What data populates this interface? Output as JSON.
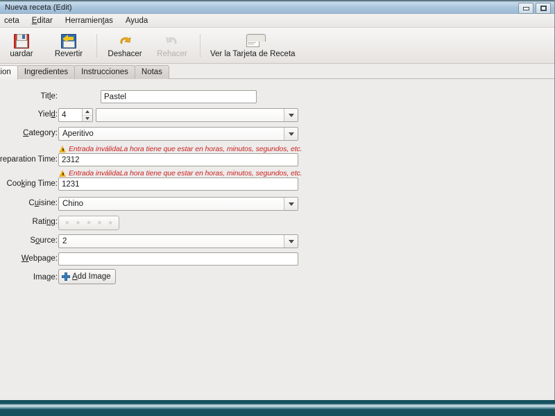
{
  "window": {
    "title": "Nueva receta (Edit)",
    "buttons": [
      {
        "name": "minimize",
        "glyph": "minimize-icon"
      },
      {
        "name": "maximize",
        "glyph": "maximize-icon"
      }
    ]
  },
  "menubar": {
    "items": [
      {
        "label": "ceta",
        "mnemonic": ""
      },
      {
        "label": "Editar",
        "mnemonic": "E"
      },
      {
        "label": "Herramientas",
        "mnemonic": "t"
      },
      {
        "label": "Ayuda",
        "mnemonic": ""
      }
    ]
  },
  "toolbar": {
    "items": [
      {
        "label": "uardar",
        "icon": "save-icon",
        "enabled": true
      },
      {
        "label": "Revertir",
        "icon": "revert-icon",
        "enabled": true
      },
      {
        "label": "Deshacer",
        "icon": "undo-icon",
        "enabled": true
      },
      {
        "label": "Rehacer",
        "icon": "redo-icon",
        "enabled": false
      },
      {
        "label": "Ver la Tarjeta de Receta",
        "icon": "recipe-card-icon",
        "enabled": true
      }
    ]
  },
  "tabs": [
    {
      "label": "scription",
      "active": true
    },
    {
      "label": "Ingredientes",
      "active": false
    },
    {
      "label": "Instrucciones",
      "active": false
    },
    {
      "label": "Notas",
      "active": false
    }
  ],
  "form": {
    "title": {
      "label": "Title:",
      "value": "Pastel"
    },
    "yield": {
      "label": "Yield:",
      "amount": "4",
      "unit": ""
    },
    "category": {
      "label": "Category:",
      "value": "Aperitivo"
    },
    "preparation_time": {
      "label": "Preparation Time:",
      "value": "2312",
      "error": "Entrada inválidaLa hora tiene que estar en horas, minutos, segundos, etc."
    },
    "cooking_time": {
      "label": "Cooking Time:",
      "value": "1231",
      "error": "Entrada inválidaLa hora tiene que estar en horas, minutos, segundos, etc."
    },
    "cuisine": {
      "label": "Cuisine:",
      "value": "Chino"
    },
    "rating": {
      "label": "Rating:",
      "stars": 0,
      "star_glyph": "★"
    },
    "source": {
      "label": "Source:",
      "value": "2"
    },
    "webpage": {
      "label": "Webpage:",
      "value": ""
    },
    "image": {
      "label": "Image:",
      "button_label": "Add Image"
    }
  },
  "colors": {
    "error_text": "#cc2222",
    "warning": "#efb219",
    "accent_blue": "#3d84c6",
    "window_bg": "#edeceb",
    "desktop": "#14505e"
  }
}
